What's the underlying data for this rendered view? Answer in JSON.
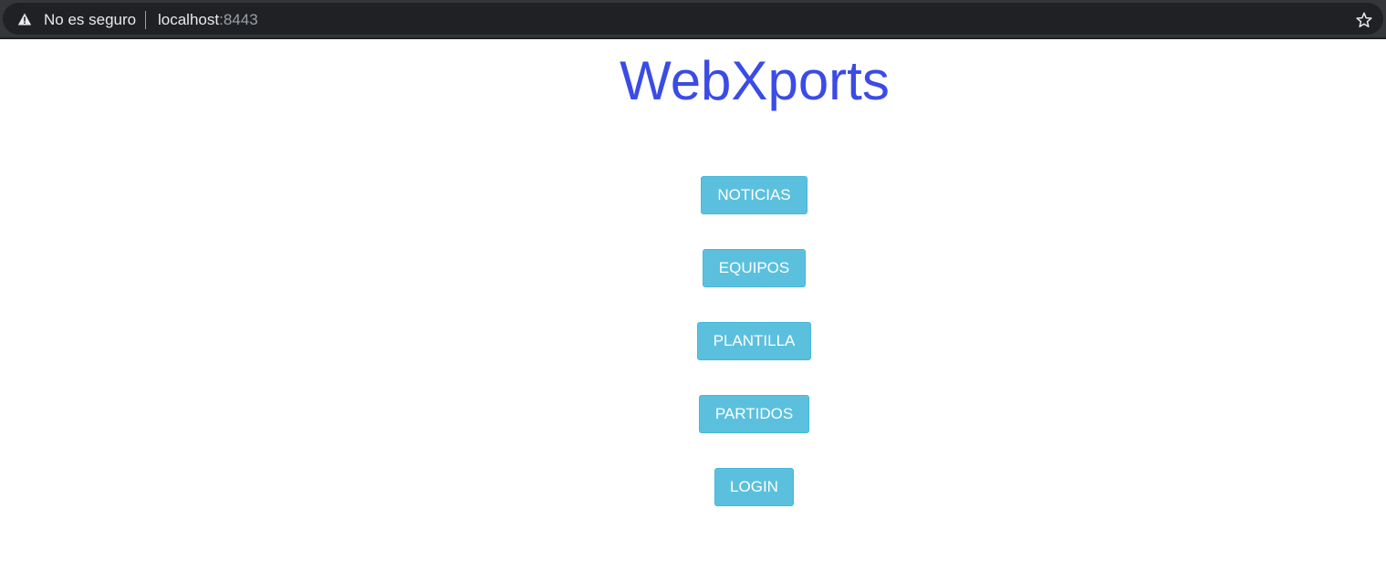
{
  "browser": {
    "security_label": "No es seguro",
    "url_host": "localhost",
    "url_port": ":8443"
  },
  "page": {
    "title": "WebXports",
    "title_color": "#3b4be6",
    "button_color": "#5bc0de",
    "nav": {
      "noticias": "NOTICIAS",
      "equipos": "EQUIPOS",
      "plantilla": "PLANTILLA",
      "partidos": "PARTIDOS",
      "login": "LOGIN"
    }
  }
}
